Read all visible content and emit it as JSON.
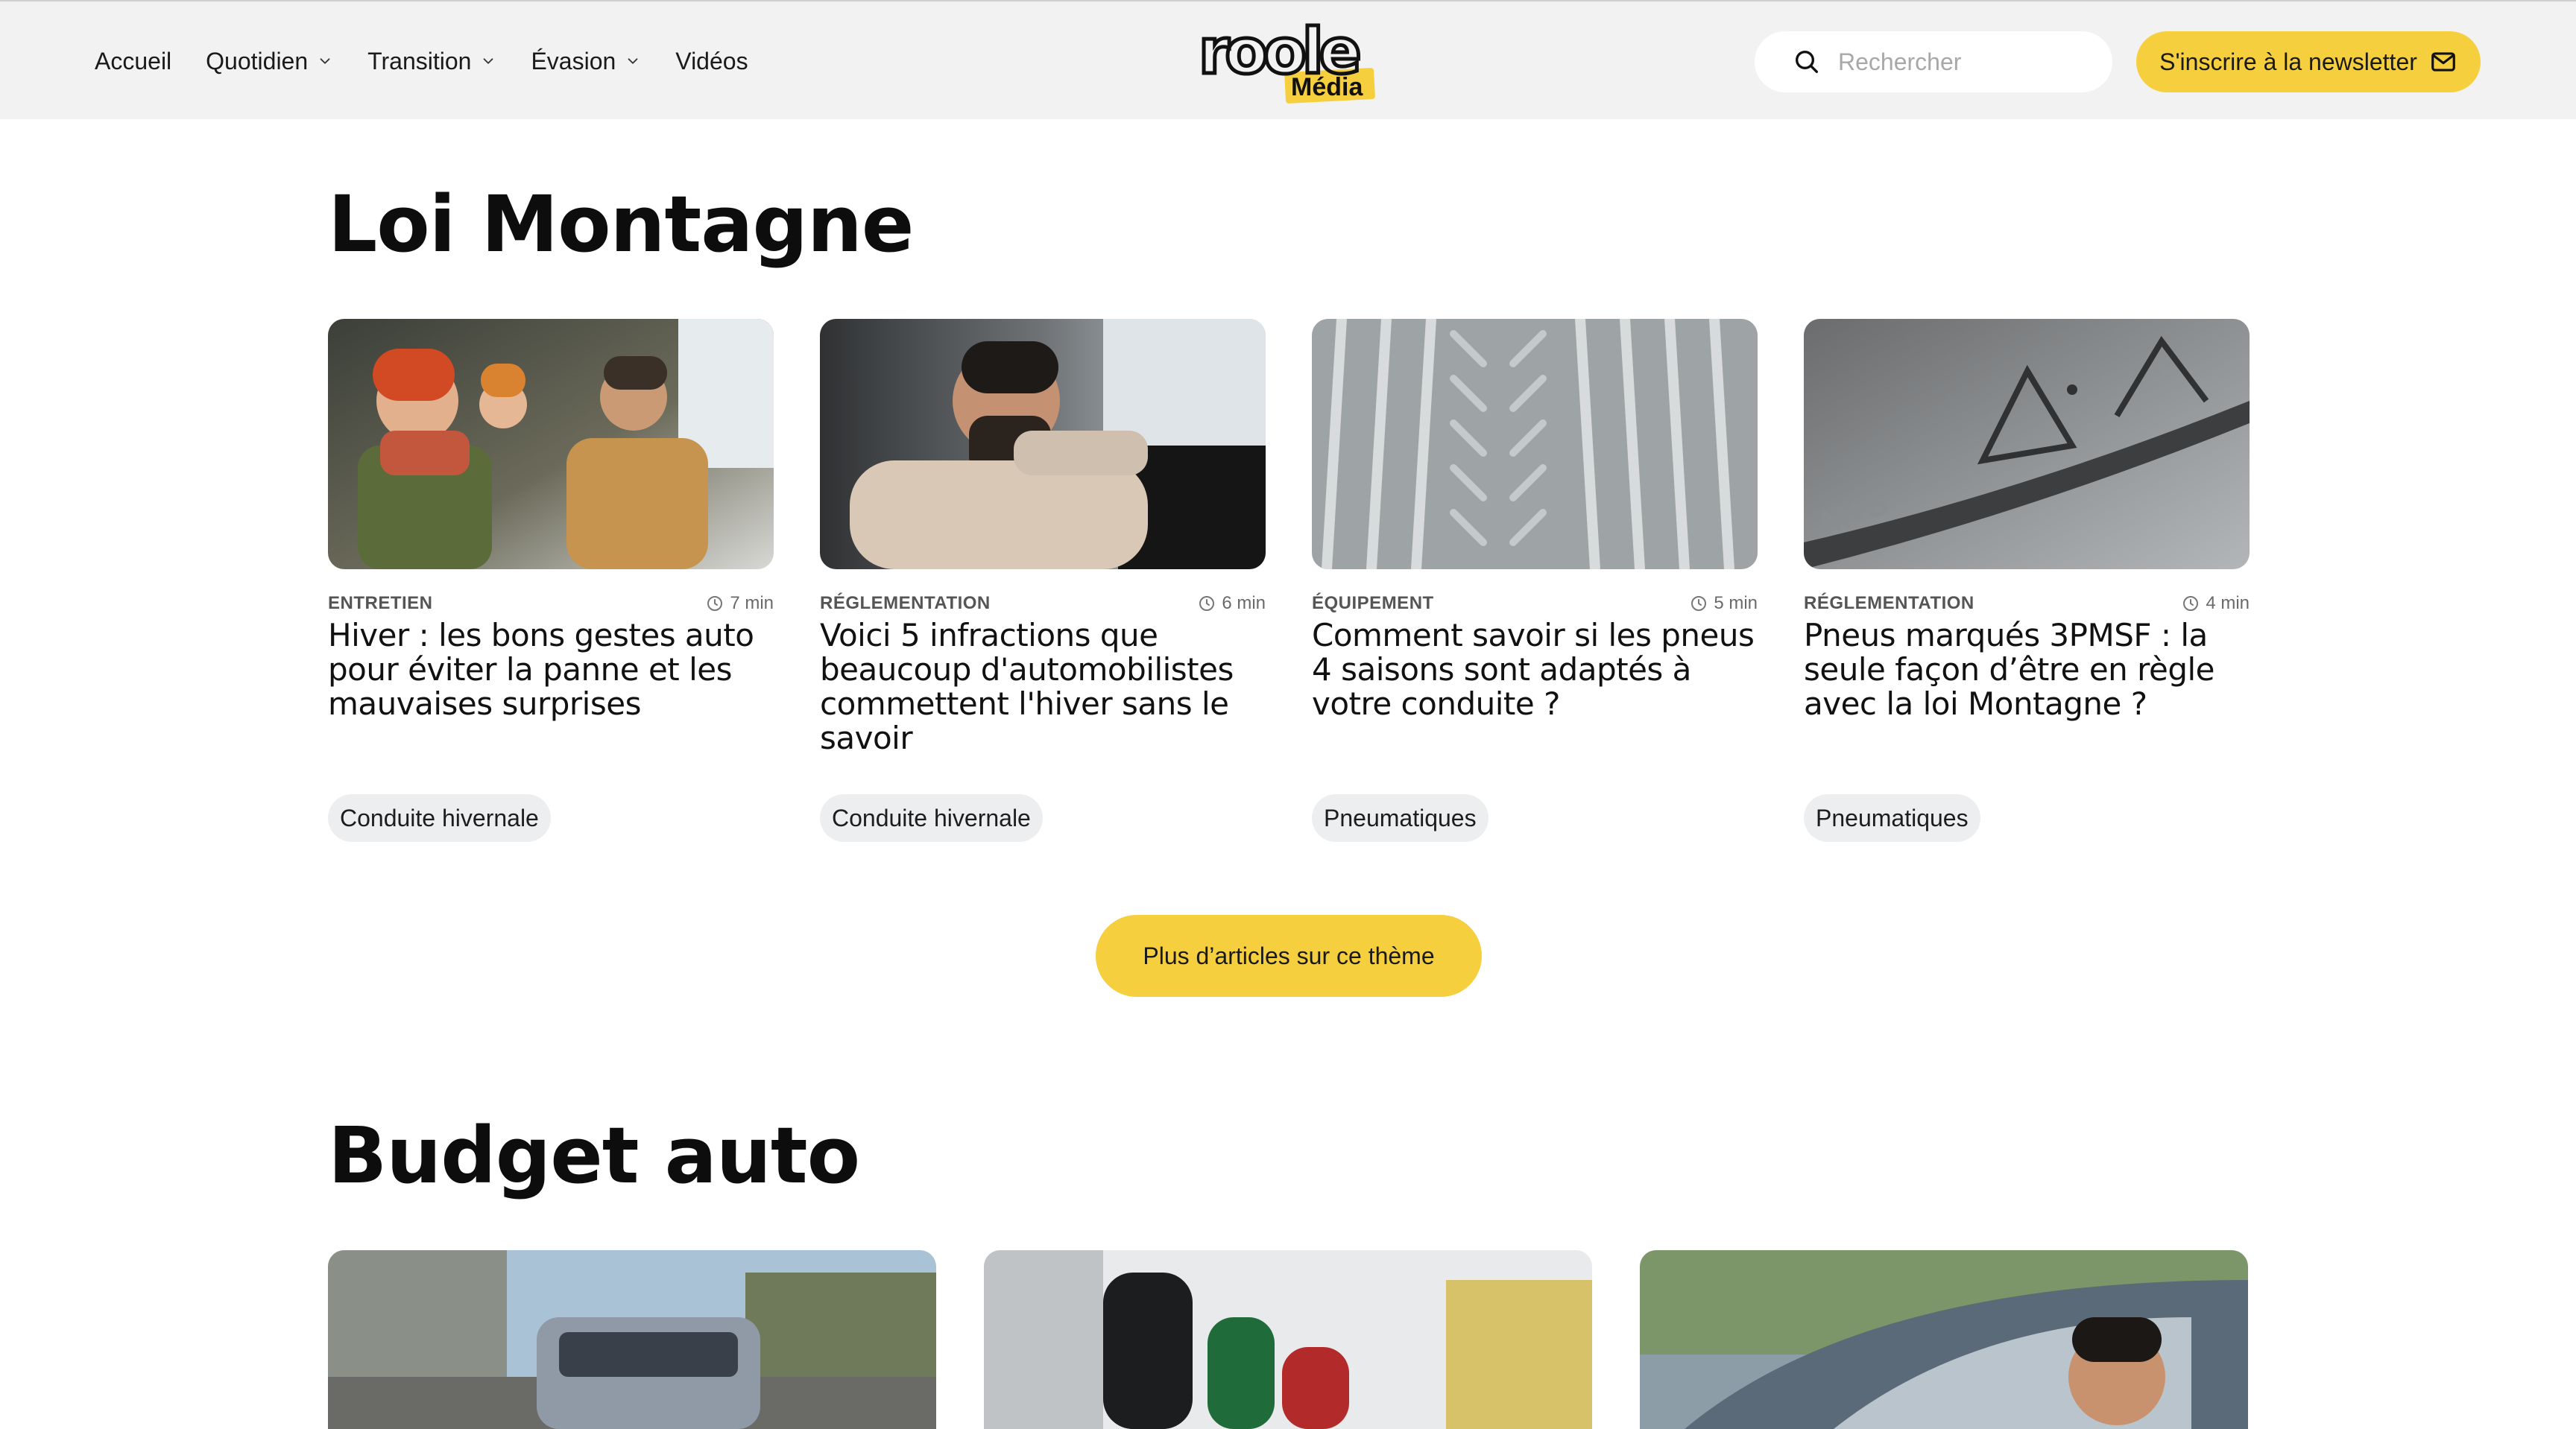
{
  "header": {
    "nav": [
      {
        "label": "Accueil",
        "dropdown": false
      },
      {
        "label": "Quotidien",
        "dropdown": true
      },
      {
        "label": "Transition",
        "dropdown": true
      },
      {
        "label": "Évasion",
        "dropdown": true
      },
      {
        "label": "Vidéos",
        "dropdown": false
      }
    ],
    "logo": {
      "word": "roole",
      "sub": "Média"
    },
    "search": {
      "placeholder": "Rechercher"
    },
    "newsletter_label": "S'inscrire à la newsletter"
  },
  "sections": [
    {
      "title": "Loi Montagne",
      "cards": [
        {
          "category": "ENTRETIEN",
          "read_time": "7 min",
          "title": "Hiver : les bons gestes auto pour éviter la panne et les mauvaises surprises",
          "tag": "Conduite hivernale"
        },
        {
          "category": "RÉGLEMENTATION",
          "read_time": "6 min",
          "title": "Voici 5 infractions que beaucoup d'automobilistes commettent l'hiver sans le savoir",
          "tag": "Conduite hivernale"
        },
        {
          "category": "ÉQUIPEMENT",
          "read_time": "5 min",
          "title": "Comment savoir si les pneus 4 saisons sont adaptés à votre conduite ?",
          "tag": "Pneumatiques"
        },
        {
          "category": "RÉGLEMENTATION",
          "read_time": "4 min",
          "title": "Pneus marqués 3PMSF : la seule façon d’être en règle avec la loi Montagne ?",
          "tag": "Pneumatiques"
        }
      ],
      "more_label": "Plus d’articles sur ce thème"
    },
    {
      "title": "Budget auto"
    }
  ],
  "colors": {
    "accent": "#f6cf3f",
    "header_bg": "#f2f2f2",
    "tag_bg": "#eceeef"
  }
}
